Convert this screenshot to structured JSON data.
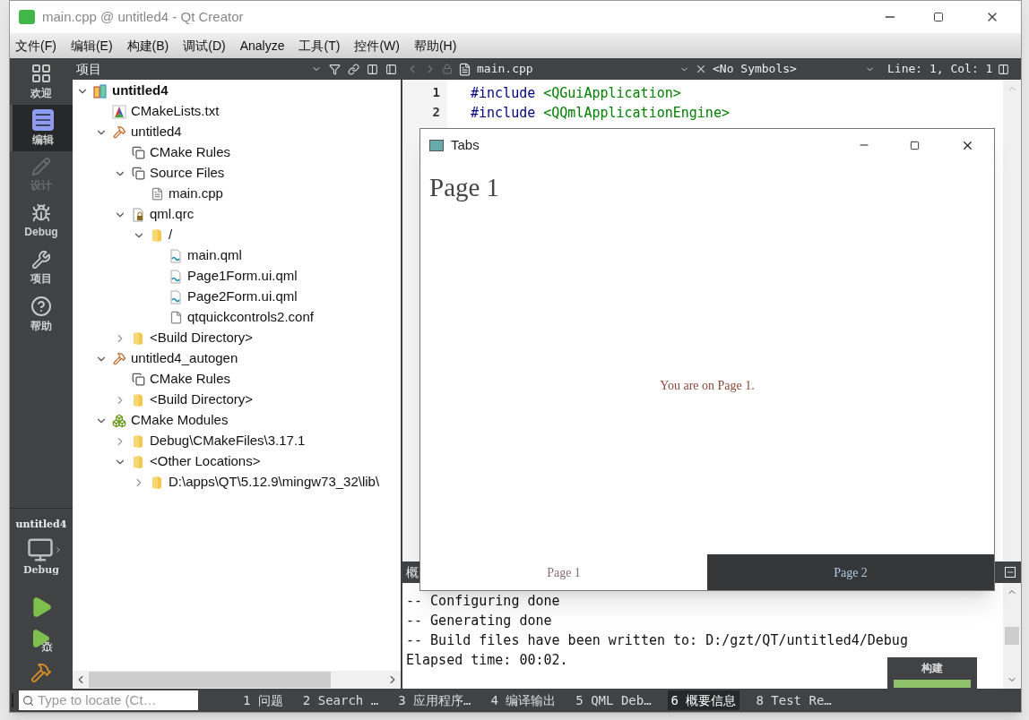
{
  "window": {
    "title": "main.cpp @ untitled4 - Qt Creator"
  },
  "menu": [
    "文件(F)",
    "编辑(E)",
    "构建(B)",
    "调试(D)",
    "Analyze",
    "工具(T)",
    "控件(W)",
    "帮助(H)"
  ],
  "modes": [
    {
      "label": "欢迎",
      "selected": false,
      "disabled": false
    },
    {
      "label": "编辑",
      "selected": true,
      "disabled": false
    },
    {
      "label": "设计",
      "selected": false,
      "disabled": true
    },
    {
      "label": "Debug",
      "selected": false,
      "disabled": false
    },
    {
      "label": "项目",
      "selected": false,
      "disabled": false
    },
    {
      "label": "帮助",
      "selected": false,
      "disabled": false
    }
  ],
  "kit": {
    "project": "untitled4",
    "config": "Debug"
  },
  "project_panel": {
    "title": "项目",
    "tree": [
      {
        "label": "untitled4",
        "kind": "project",
        "expanded": true,
        "children": [
          {
            "label": "CMakeLists.txt",
            "kind": "cmake"
          },
          {
            "label": "untitled4",
            "kind": "target",
            "expanded": true,
            "children": [
              {
                "label": "CMake Rules",
                "kind": "group"
              },
              {
                "label": "Source Files",
                "kind": "group",
                "expanded": true,
                "children": [
                  {
                    "label": "main.cpp",
                    "kind": "file"
                  }
                ]
              },
              {
                "label": "qml.qrc",
                "kind": "qrc",
                "expanded": true,
                "children": [
                  {
                    "label": "/",
                    "kind": "folder",
                    "expanded": true,
                    "children": [
                      {
                        "label": "main.qml",
                        "kind": "qml"
                      },
                      {
                        "label": "Page1Form.ui.qml",
                        "kind": "qml"
                      },
                      {
                        "label": "Page2Form.ui.qml",
                        "kind": "qml"
                      },
                      {
                        "label": "qtquickcontrols2.conf",
                        "kind": "plain"
                      }
                    ]
                  }
                ]
              },
              {
                "label": "<Build Directory>",
                "kind": "folder",
                "expanded": false
              }
            ]
          },
          {
            "label": "untitled4_autogen",
            "kind": "target",
            "expanded": true,
            "children": [
              {
                "label": "CMake Rules",
                "kind": "group"
              },
              {
                "label": "<Build Directory>",
                "kind": "folder",
                "expanded": false
              }
            ]
          },
          {
            "label": "CMake Modules",
            "kind": "modules",
            "expanded": true,
            "children": [
              {
                "label": "Debug\\CMakeFiles\\3.17.1",
                "kind": "folder",
                "expanded": false
              },
              {
                "label": "<Other Locations>",
                "kind": "folder",
                "expanded": true,
                "children": [
                  {
                    "label": "D:\\apps\\QT\\5.12.9\\mingw73_32\\lib\\",
                    "kind": "folder",
                    "expanded": false
                  }
                ]
              }
            ]
          }
        ]
      }
    ]
  },
  "editor": {
    "file": "main.cpp",
    "symbols": "<No Symbols>",
    "position": "Line: 1, Col: 1",
    "lines": [
      {
        "number": "1",
        "directive": "#include",
        "header": "<QGuiApplication>"
      },
      {
        "number": "2",
        "directive": "#include",
        "header": "<QQmlApplicationEngine>"
      }
    ]
  },
  "output": {
    "title": "概",
    "lines": [
      "-- Configuring done",
      "-- Generating done",
      "-- Build files have been written to: D:/gzt/QT/untitled4/Debug",
      "Elapsed time: 00:02."
    ]
  },
  "build_progress": {
    "label": "构建",
    "level": 1
  },
  "status_bar": {
    "locate_placeholder": "Type to locate (Ct…",
    "panes": [
      {
        "label": "1 问题",
        "selected": false
      },
      {
        "label": "2 Search …",
        "selected": false
      },
      {
        "label": "3 应用程序…",
        "selected": false
      },
      {
        "label": "4 编译输出",
        "selected": false
      },
      {
        "label": "5 QML Deb…",
        "selected": false
      },
      {
        "label": "6 概要信息",
        "selected": true
      },
      {
        "label": "8 Test Re…",
        "selected": false
      }
    ]
  },
  "app_window": {
    "title": "Tabs",
    "heading": "Page 1",
    "message": "You are on Page 1.",
    "tabs": [
      {
        "label": "Page 1",
        "selected": true
      },
      {
        "label": "Page 2",
        "selected": false
      }
    ]
  }
}
